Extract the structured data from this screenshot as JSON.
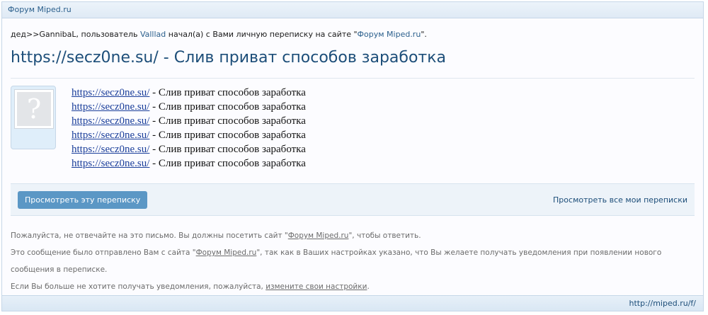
{
  "header": {
    "title": "Форум Miped.ru"
  },
  "intro": {
    "sender": "дед>>GannibaL",
    "text1": ", пользователь ",
    "user": "Valllad",
    "text2": " начал(а) с Вами личную переписку на сайте \"",
    "site": "Форум Miped.ru",
    "text3": "\"."
  },
  "title": "https://secz0ne.su/ - Слив приват способов заработка",
  "message": {
    "lines": [
      {
        "link": "https://secz0ne.su/",
        "text": " - Слив приват способов заработка"
      },
      {
        "link": "https://secz0ne.su/",
        "text": " - Слив приват способов заработка"
      },
      {
        "link": "https://secz0ne.su/",
        "text": " - Слив приват способов заработка"
      },
      {
        "link": "https://secz0ne.su/",
        "text": " - Слив приват способов заработка"
      },
      {
        "link": "https://secz0ne.su/",
        "text": " - Слив приват способов заработка"
      },
      {
        "link": "https://secz0ne.su/",
        "text": " - Слив приват способов заработка"
      }
    ]
  },
  "actions": {
    "view_button": "Просмотреть эту переписку",
    "view_all": "Просмотреть все мои переписки"
  },
  "notes": {
    "line1_a": "Пожалуйста, не отвечайте на это письмо. Вы должны посетить сайт \"",
    "line1_site": "Форум Miped.ru",
    "line1_b": "\", чтобы ответить.",
    "line2_a": "Это сообщение было отправлено Вам с сайта \"",
    "line2_site": "Форум Miped.ru",
    "line2_b": "\", так как в Ваших настройках указано, что Вы желаете получать уведомления при появлении нового сообщения в переписке.",
    "line3_a": "Если Вы больше не хотите получать уведомления, пожалуйста, ",
    "line3_link": "измените свои настройки",
    "line3_b": "."
  },
  "footer": {
    "url": "http://miped.ru/f/"
  },
  "icons": {
    "avatar": "question-mark-avatar-icon"
  }
}
